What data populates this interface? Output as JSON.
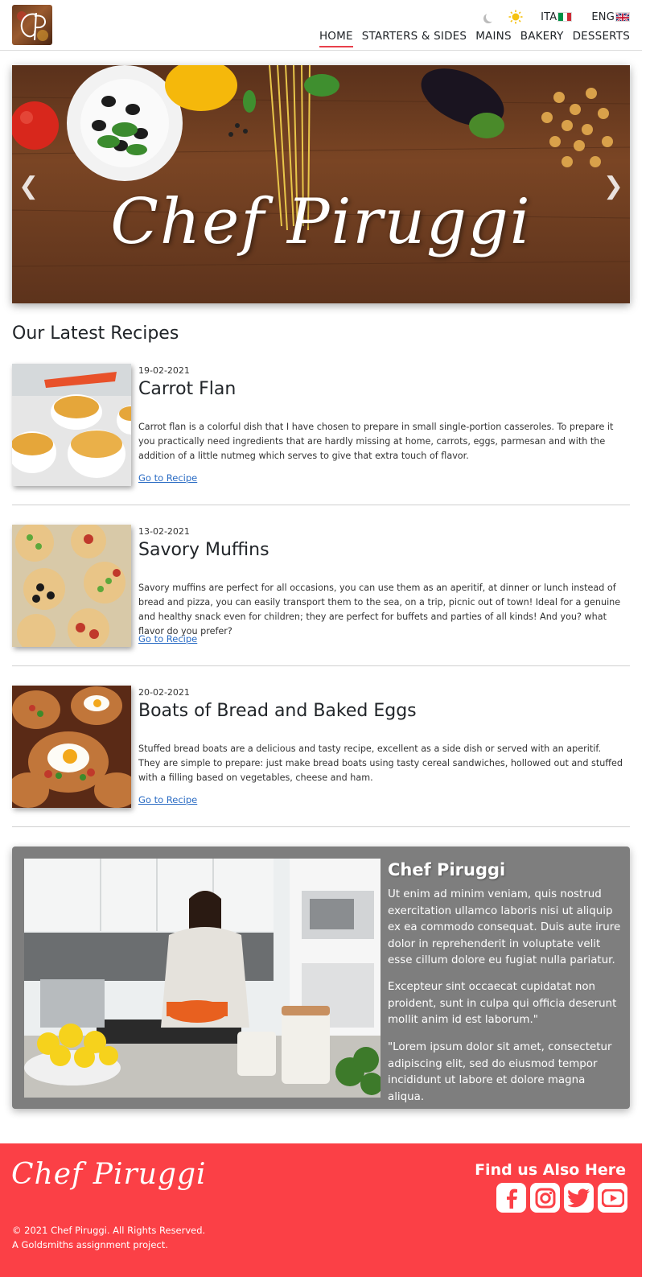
{
  "header": {
    "logo_text": "CP",
    "languages": [
      {
        "label": "ITA",
        "flag": "italy"
      },
      {
        "label": "ENG",
        "flag": "uk"
      }
    ],
    "nav": [
      "HOME",
      "STARTERS & SIDES",
      "MAINS",
      "BAKERY",
      "DESSERTS"
    ],
    "active_nav": "HOME"
  },
  "hero": {
    "title": "Chef Piruggi",
    "prev_icon": "chevron-left-icon",
    "next_icon": "chevron-right-icon"
  },
  "latest": {
    "title": "Our Latest Recipes",
    "recipes": [
      {
        "date": "19-02-2021",
        "title": "Carrot Flan",
        "description": "Carrot flan is a colorful dish that I have chosen to prepare in small single-portion casseroles. To prepare it you practically need ingredients that are hardly missing at home, carrots, eggs, parmesan and with the addition of a little nutmeg which serves to give that extra touch of flavor.",
        "link": "Go to Recipe"
      },
      {
        "date": "13-02-2021",
        "title": "Savory Muffins",
        "description": "Savory muffins are perfect for all occasions, you can use them as an aperitif, at dinner or lunch instead of bread and pizza, you can easily transport them to the sea, on a trip, picnic out of town! Ideal for a genuine and healthy snack even for children; they are perfect for buffets and parties of all kinds! And you? what flavor do you prefer?",
        "link": "Go to Recipe"
      },
      {
        "date": "20-02-2021",
        "title": "Boats of Bread and Baked Eggs",
        "description": "Stuffed bread boats are a delicious and tasty recipe, excellent as a side dish or served with an aperitif. They are simple to prepare: just make bread boats using tasty cereal sandwiches, hollowed out and stuffed with a filling based on vegetables, cheese and ham.",
        "link": "Go to Recipe"
      }
    ]
  },
  "chef": {
    "name": "Chef Piruggi",
    "paragraphs": [
      "Ut enim ad minim veniam, quis nostrud exercitation ullamco laboris nisi ut aliquip ex ea commodo consequat. Duis aute irure dolor in reprehenderit in voluptate velit esse cillum dolore eu fugiat nulla pariatur.",
      "Excepteur sint occaecat cupidatat non proident, sunt in culpa qui officia deserunt mollit anim id est laborum.\"",
      "\"Lorem ipsum dolor sit amet, consectetur adipiscing elit, sed do eiusmod tempor incididunt ut labore et dolore magna aliqua."
    ]
  },
  "footer": {
    "logo_text": "Chef Piruggi",
    "copyright": "© 2021 Chef Piruggi. All Rights Reserved.",
    "note": "A Goldsmiths assignment project.",
    "find_us": "Find us Also Here",
    "socials": [
      "facebook-icon",
      "instagram-icon",
      "twitter-icon",
      "youtube-icon"
    ]
  },
  "colors": {
    "accent": "#fb4046",
    "link": "#2b6cc4",
    "card": "#7e7e7e"
  }
}
